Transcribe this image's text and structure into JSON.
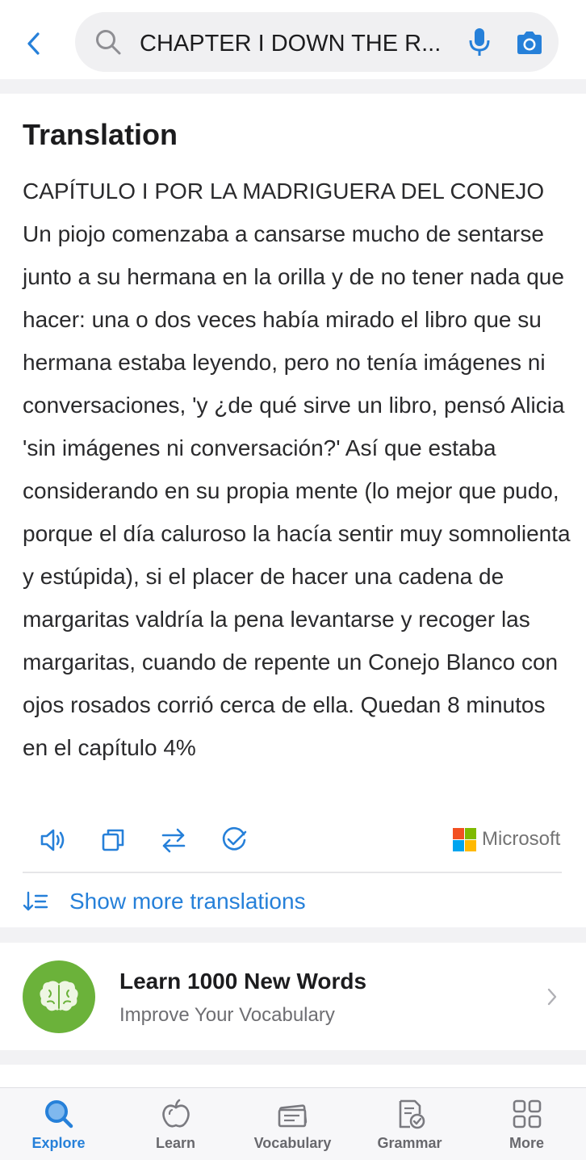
{
  "search": {
    "query": "CHAPTER I DOWN THE R...",
    "back_icon": "chevron-left-icon",
    "search_icon": "magnifier-icon",
    "mic_icon": "microphone-icon",
    "camera_icon": "camera-icon"
  },
  "translation": {
    "title": "Translation",
    "text": "CAPÍTULO I POR LA MADRIGUERA DEL CONEJO Un piojo comenzaba a cansarse mucho de sentarse junto a su hermana en la orilla y de no tener nada que hacer: una o dos veces había mirado el libro que su hermana estaba leyendo, pero no tenía imágenes ni conversaciones, 'y ¿de qué sirve un libro,  pensó Alicia 'sin imágenes ni conversación?' Así que estaba considerando en su propia mente (lo mejor que pudo, porque el día caluroso la hacía sentir muy somnolienta y estúpida), si el placer de hacer una cadena de margaritas valdría la pena levantarse y recoger las margaritas, cuando de repente un Conejo Blanco con ojos rosados corrió cerca de ella. Quedan 8 minutos en el capítulo 4%",
    "actions": [
      "speaker-icon",
      "copy-icon",
      "swap-icon",
      "check-circle-icon"
    ],
    "provider": "Microsoft",
    "provider_colors": [
      "#f25022",
      "#7fba00",
      "#00a4ef",
      "#ffb900"
    ],
    "more_label": "Show more translations"
  },
  "promo": {
    "title": "Learn 1000 New Words",
    "subtitle": "Improve Your Vocabulary",
    "icon": "brain-icon"
  },
  "tabs": [
    {
      "label": "Explore",
      "icon": "explore-search-icon",
      "active": true
    },
    {
      "label": "Learn",
      "icon": "apple-icon",
      "active": false
    },
    {
      "label": "Vocabulary",
      "icon": "flashcards-icon",
      "active": false
    },
    {
      "label": "Grammar",
      "icon": "grammar-check-icon",
      "active": false
    },
    {
      "label": "More",
      "icon": "grid-icon",
      "active": false
    }
  ],
  "colors": {
    "accent": "#2680d9",
    "promo_green": "#6bb23a",
    "background": "#f2f2f4"
  }
}
